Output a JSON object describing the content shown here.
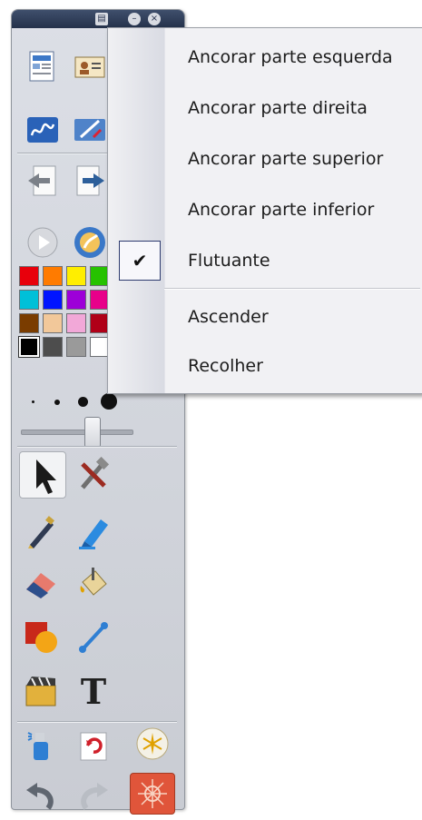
{
  "toolbar": {
    "titlebar_buttons": [
      "menu-icon",
      "minimize-icon",
      "close-icon"
    ],
    "colors": [
      [
        "#e8000b",
        "#ff7b00",
        "#ffee00",
        "#26c200"
      ],
      [
        "#00c0d8",
        "#0014ff",
        "#9d00d8",
        "#e8008a"
      ],
      [
        "#7a3c00",
        "#f2c89a",
        "#f2a8d8",
        "#b00018"
      ],
      [
        "#000000",
        "#4d4d4d",
        "#9a9a9a",
        "#ffffff"
      ]
    ],
    "pen_sizes": [
      "small",
      "medium",
      "large",
      "extra-large"
    ],
    "slider_value": 0.62,
    "tools": [
      "select-pointer",
      "settings-tools",
      "pen",
      "highlighter",
      "eraser",
      "fill-bucket",
      "shapes",
      "line",
      "media",
      "text",
      "clear-spray",
      "refresh",
      "recorder",
      "undo",
      "redo",
      "magic-effect"
    ],
    "text_tool_glyph": "T"
  },
  "menu": {
    "items": [
      {
        "label": "Ancorar parte esquerda",
        "checked": false
      },
      {
        "label": "Ancorar parte direita",
        "checked": false
      },
      {
        "label": "Ancorar parte superior",
        "checked": false
      },
      {
        "label": "Ancorar parte inferior",
        "checked": false
      },
      {
        "label": "Flutuante",
        "checked": true
      },
      {
        "label": "Ascender",
        "checked": false
      },
      {
        "label": "Recolher",
        "checked": false
      }
    ],
    "check_glyph": "✔"
  }
}
